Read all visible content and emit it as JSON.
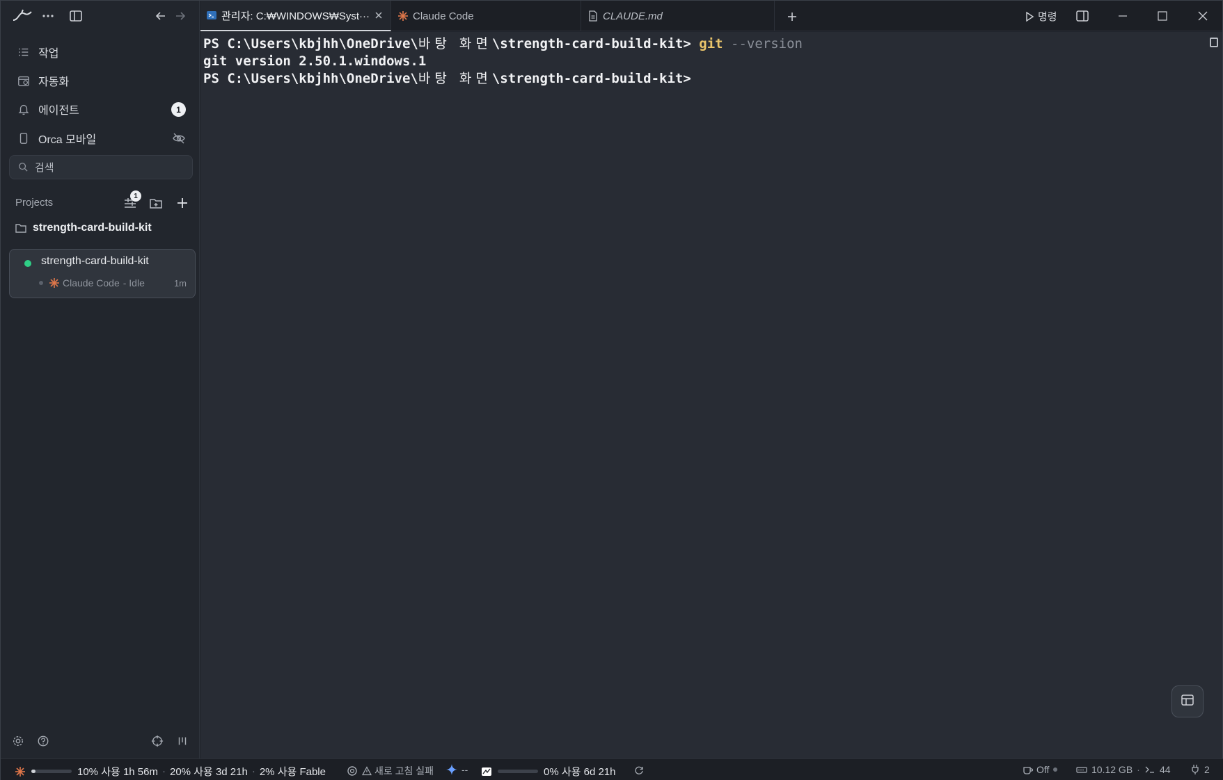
{
  "tabs": [
    {
      "label": "관리자: C:₩WINDOWS₩Syst···",
      "icon": "powershell-icon",
      "active": true
    },
    {
      "label": "Claude Code",
      "icon": "claude-icon",
      "active": false
    },
    {
      "label": "CLAUDE.md",
      "icon": "file-icon",
      "active": false
    }
  ],
  "header": {
    "command_label": "명령"
  },
  "sidebar": {
    "nav": [
      {
        "label": "작업",
        "icon": "list-icon"
      },
      {
        "label": "자동화",
        "icon": "calendar-icon"
      },
      {
        "label": "에이전트",
        "icon": "bell-icon",
        "badge": "1"
      },
      {
        "label": "Orca 모바일",
        "icon": "phone-icon"
      }
    ],
    "search_placeholder": "검색",
    "projects_label": "Projects",
    "filter_badge": "1",
    "project_name": "strength-card-build-kit",
    "worktree": {
      "name": "strength-card-build-kit",
      "agent": "Claude Code",
      "status": "- Idle",
      "time": "1m"
    }
  },
  "terminal": {
    "line1_prompt": "PS C:\\Users\\kbjhh\\OneDrive\\",
    "line1_ko": "바탕 화면",
    "line1_rest": "\\strength-card-build-kit> ",
    "line1_cmd": "git",
    "line1_arg": " --version",
    "line2": "git version 2.50.1.windows.1",
    "line3_prompt": "PS C:\\Users\\kbjhh\\OneDrive\\",
    "line3_ko": "바탕 화면",
    "line3_rest": "\\strength-card-build-kit>"
  },
  "status": {
    "claude_session": "10% 사용 1h 56m",
    "claude_week": "20% 사용 3d 21h",
    "claude_fable": "2% 사용 Fable",
    "openai_status": "새로 고침 실패",
    "gemini_status": "--",
    "other_usage": "0% 사용 6d 21h",
    "claude_session_pct": 10,
    "other_usage_pct": 0,
    "caffeine": "Off",
    "memory": "10.12 GB",
    "terminals": "44",
    "ports": "2"
  },
  "colors": {
    "accent_green": "#2fcf86",
    "claude_orange": "#e0774a",
    "command_yellow": "#e9c46a"
  }
}
